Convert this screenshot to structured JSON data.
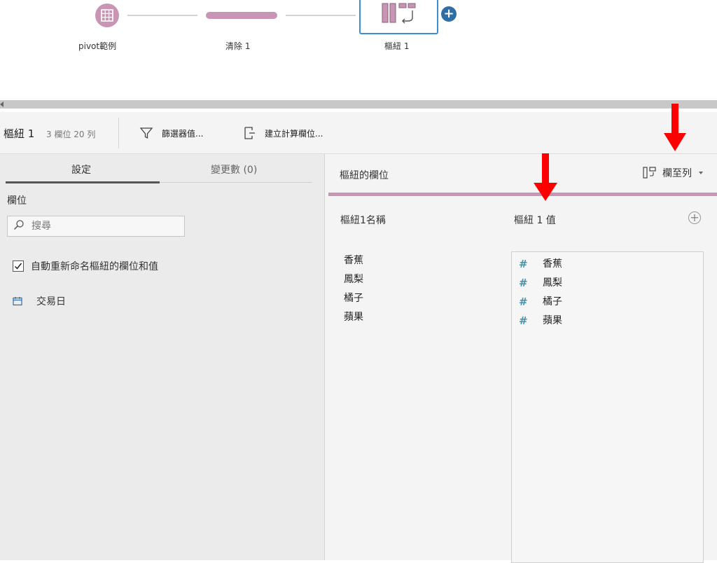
{
  "flow": {
    "nodes": [
      {
        "id": "source",
        "label": "pivot範例"
      },
      {
        "id": "clean",
        "label": "清除 1"
      },
      {
        "id": "pivot",
        "label": "樞紐 1"
      }
    ]
  },
  "toolbar": {
    "title": "樞紐 1",
    "meta": "3 欄位  20 列",
    "filter_label": "篩選器值...",
    "calc_label": "建立計算欄位..."
  },
  "left": {
    "tabs": [
      {
        "label": "設定",
        "active": true
      },
      {
        "label": "變更數 (0)",
        "active": false
      }
    ],
    "fields_heading": "欄位",
    "search_placeholder": "搜尋",
    "auto_rename_label": "自動重新命名樞紐的欄位和值",
    "auto_rename_checked": true,
    "fields": [
      {
        "type_icon": "calendar-icon",
        "name": "交易日"
      }
    ]
  },
  "right": {
    "title": "樞紐的欄位",
    "mode_label": "欄至列",
    "names_header": "樞紐1名稱",
    "values_header": "樞紐 1 值",
    "names": [
      "香蕉",
      "鳳梨",
      "橘子",
      "蘋果"
    ],
    "values": [
      "香蕉",
      "鳳梨",
      "橘子",
      "蘋果"
    ]
  },
  "colors": {
    "accent_pink": "#c896b4",
    "selection_blue": "#3d8ed0",
    "add_button": "#2f6fa6",
    "number_type": "#4a93a8",
    "annotation_arrow": "#ff0000"
  }
}
